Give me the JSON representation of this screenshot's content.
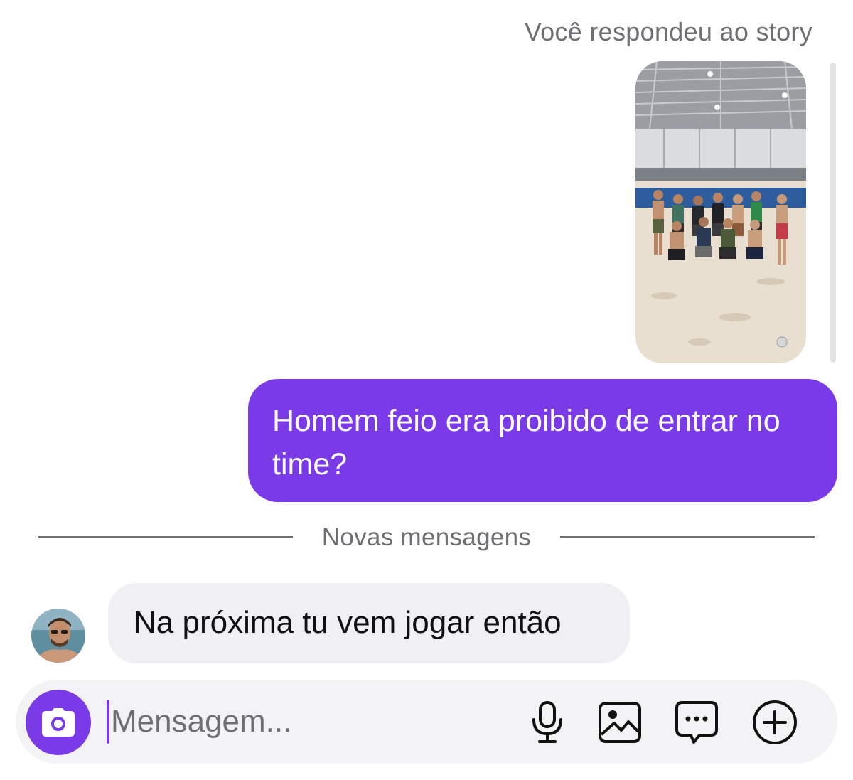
{
  "story": {
    "caption": "Você respondeu ao story"
  },
  "messages": {
    "outgoing": "Homem feio era proibido de entrar no time?",
    "divider_label": "Novas mensagens",
    "incoming": "Na próxima tu vem jogar então"
  },
  "composer": {
    "placeholder": "Mensagem..."
  },
  "icons": {
    "camera": "camera-icon",
    "mic": "microphone-icon",
    "gallery": "image-icon",
    "sticker": "chat-bubble-icon",
    "plus": "plus-circle-icon"
  },
  "colors": {
    "accent": "#7b3ae8",
    "incoming_bubble": "#efeff4",
    "muted_text": "#6e6e73"
  }
}
